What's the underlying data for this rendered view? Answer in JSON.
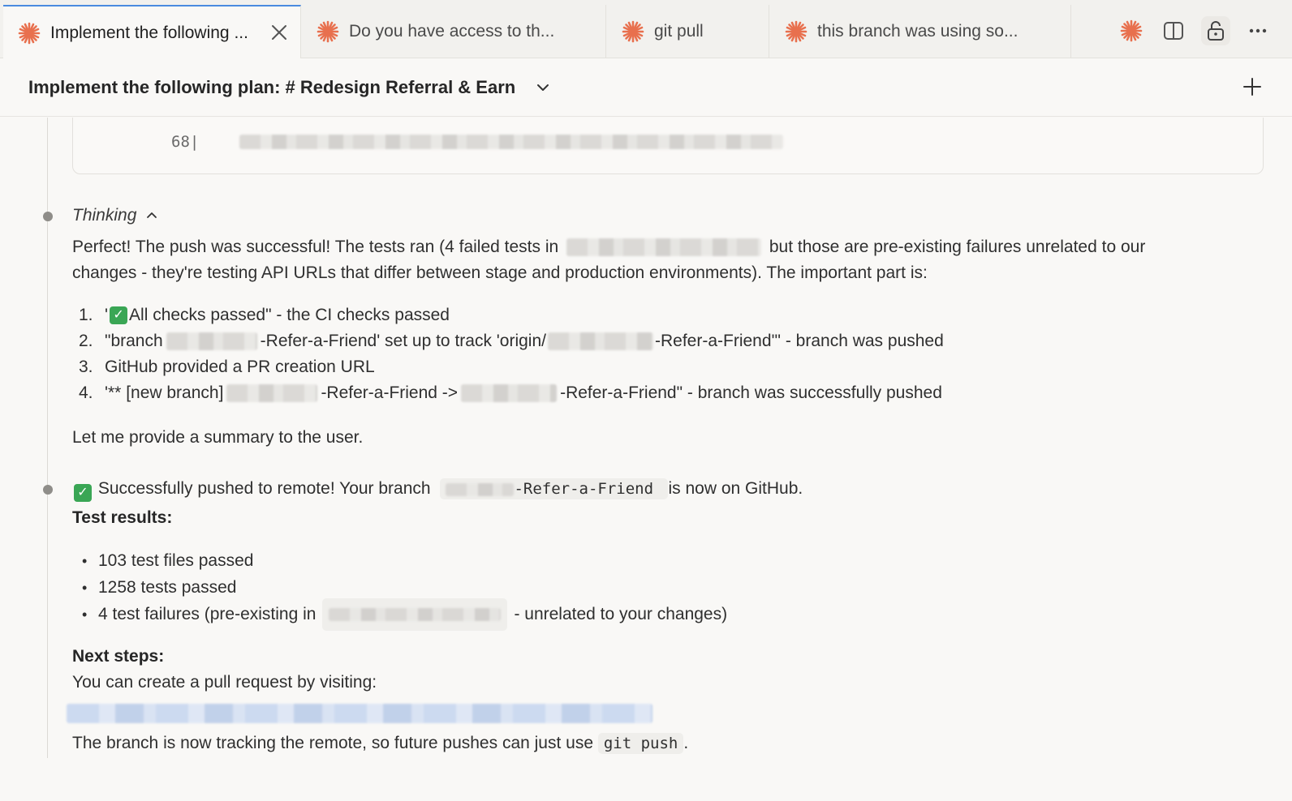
{
  "tabs": [
    {
      "label": "Implement the following ...",
      "active": true
    },
    {
      "label": "Do you have access to th...",
      "active": false
    },
    {
      "label": "git pull",
      "active": false
    },
    {
      "label": "this branch was using so...",
      "active": false
    }
  ],
  "header": {
    "title": "Implement the following plan: # Redesign Referral & Earn"
  },
  "code_snippet": {
    "line_number": "68|"
  },
  "thinking": {
    "label": "Thinking",
    "para1_a": "Perfect! The push was successful! The tests ran (4 failed tests in",
    "para1_b": "but those are pre-existing failures unrelated to our",
    "para1_c": "changes - they're testing API URLs that differ between stage and production environments). The important part is:",
    "steps": [
      {
        "num": "1.",
        "pre": "'",
        "post": "All checks passed\" - the CI checks passed"
      },
      {
        "num": "2.",
        "pre": "\"branch",
        "mid": "-Refer-a-Friend' set up to track 'origin/",
        "post": "-Refer-a-Friend'\" - branch was pushed"
      },
      {
        "num": "3.",
        "text": "GitHub provided a PR creation URL"
      },
      {
        "num": "4.",
        "pre": "'** [new branch]",
        "mid": "-Refer-a-Friend ->",
        "post": "-Refer-a-Friend\" - branch was successfully pushed"
      }
    ],
    "closing": "Let me provide a summary to the user."
  },
  "summary": {
    "pushed_a": "Successfully pushed to remote! Your branch",
    "branch_suffix": "-Refer-a-Friend",
    "pushed_b": "is now on GitHub.",
    "test_results_heading": "Test results:",
    "results": [
      {
        "text": "103 test files passed"
      },
      {
        "text": "1258 tests passed"
      },
      {
        "pre": "4 test failures (pre-existing in",
        "post": "- unrelated to your changes)"
      }
    ],
    "next_steps_heading": "Next steps:",
    "pr_text": "You can create a pull request by visiting:",
    "tracking_a": "The branch is now tracking the remote, so future pushes can just use",
    "tracking_code": "git push",
    "tracking_b": "."
  },
  "icons": {
    "tab_icon": "claude-spark-icon",
    "accent_color": "#e8704e",
    "active_tab_border": "#4a8be0"
  }
}
